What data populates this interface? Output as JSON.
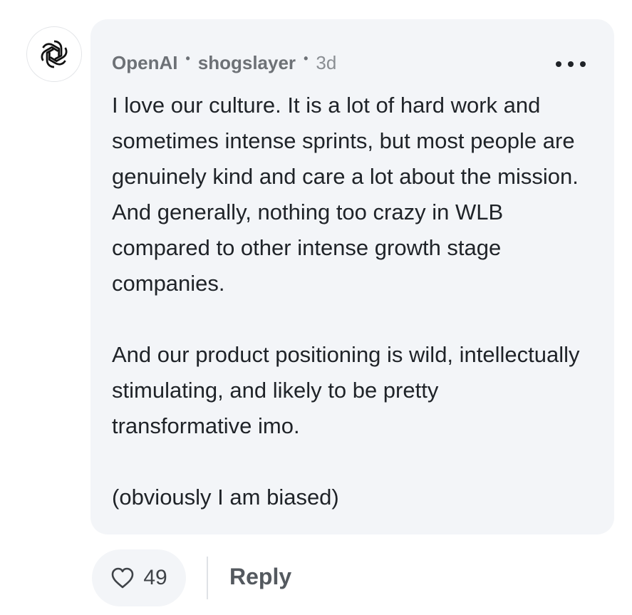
{
  "comment": {
    "company": "OpenAI",
    "author": "shogslayer",
    "age": "3d",
    "separator": "•",
    "paragraphs": [
      "I love our culture. It is a lot of hard work and sometimes intense sprints, but most people are genuinely kind and care a lot about the mission. And generally, nothing too crazy in WLB compared to other intense growth stage companies.",
      "And our product positioning is wild, intellectually stimulating, and likely to be pretty transformative imo.",
      "(obviously I am biased)"
    ]
  },
  "actions": {
    "like_count": "49",
    "reply_label": "Reply"
  },
  "icons": {
    "avatar": "openai-logo-icon",
    "more": "more-horizontal-icon",
    "like": "heart-outline-icon"
  },
  "colors": {
    "bubble_background": "#f3f5f8",
    "text": "#1f2328",
    "meta_text": "#6d7176"
  }
}
